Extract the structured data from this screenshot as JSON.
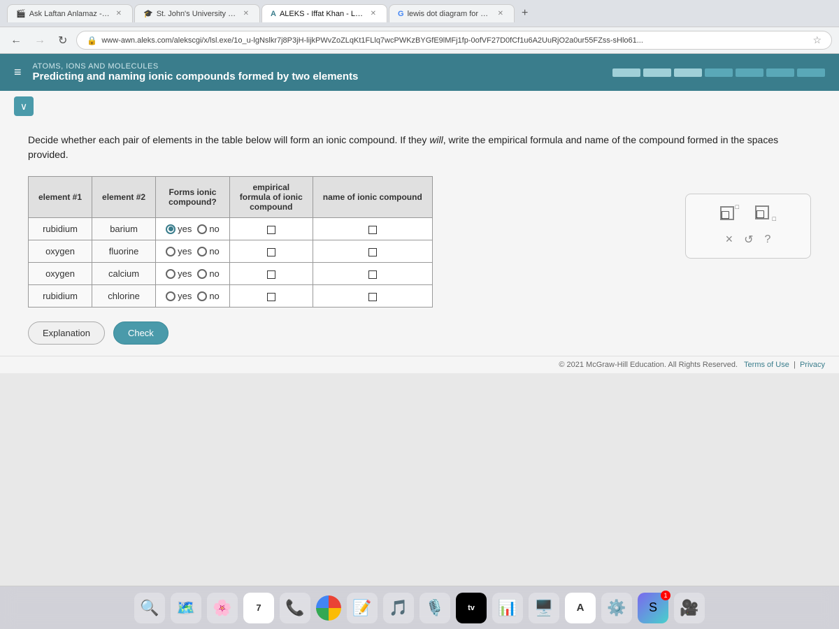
{
  "browser": {
    "tabs": [
      {
        "id": "tab1",
        "label": "Ask Laftan Anlamaz - Episode",
        "active": false,
        "favicon": "🎬"
      },
      {
        "id": "tab2",
        "label": "St. John's University - My App",
        "active": false,
        "favicon": "🎓"
      },
      {
        "id": "tab3",
        "label": "ALEKS - Iffat Khan - Learn",
        "active": true,
        "favicon": "A"
      },
      {
        "id": "tab4",
        "label": "lewis dot diagram for B - Goog",
        "active": false,
        "favicon": "G"
      }
    ],
    "address": "www-awn.aleks.com/alekscgi/x/lsl.exe/1o_u-lgNslkr7j8P3jH-lijkPWvZoZLqKt1FLlq7wcPWKzBYGfE9lMFj1fp-0ofVF27D0fCf1u6A2UuRjO2a0ur55FZss-sHlo61..."
  },
  "header": {
    "subtitle": "ATOMS, IONS AND MOLECULES",
    "title": "Predicting and naming ionic compounds formed by two elements"
  },
  "instructions": "Decide whether each pair of elements in the table below will form an ionic compound. If they will, write the empirical formula and name of the compound formed in the spaces provided.",
  "table": {
    "columns": [
      "element #1",
      "element #2",
      "Forms ionic compound?",
      "empirical formula of ionic compound",
      "name of ionic compound"
    ],
    "rows": [
      {
        "el1": "rubidium",
        "el2": "barium",
        "yes_selected": true
      },
      {
        "el1": "oxygen",
        "el2": "fluorine",
        "yes_selected": false
      },
      {
        "el1": "oxygen",
        "el2": "calcium",
        "yes_selected": false
      },
      {
        "el1": "rubidium",
        "el2": "chlorine",
        "yes_selected": false
      }
    ]
  },
  "feedback": {
    "x_label": "×",
    "undo_label": "↺",
    "help_label": "?"
  },
  "buttons": {
    "explanation": "Explanation",
    "check": "Check"
  },
  "footer": {
    "copyright": "© 2021 McGraw-Hill Education. All Rights Reserved.",
    "terms": "Terms of Use",
    "privacy": "Privacy"
  },
  "dock": {
    "items": [
      "🔍",
      "🗺️",
      "📷",
      "📅",
      "📂",
      "🌐",
      "⚡",
      "🎵",
      "📻",
      "📺",
      "📊",
      "🖥️",
      "🅰️",
      "⚙️",
      "S",
      "🎥"
    ]
  },
  "progress": {
    "segments": 7,
    "filled": 3
  }
}
